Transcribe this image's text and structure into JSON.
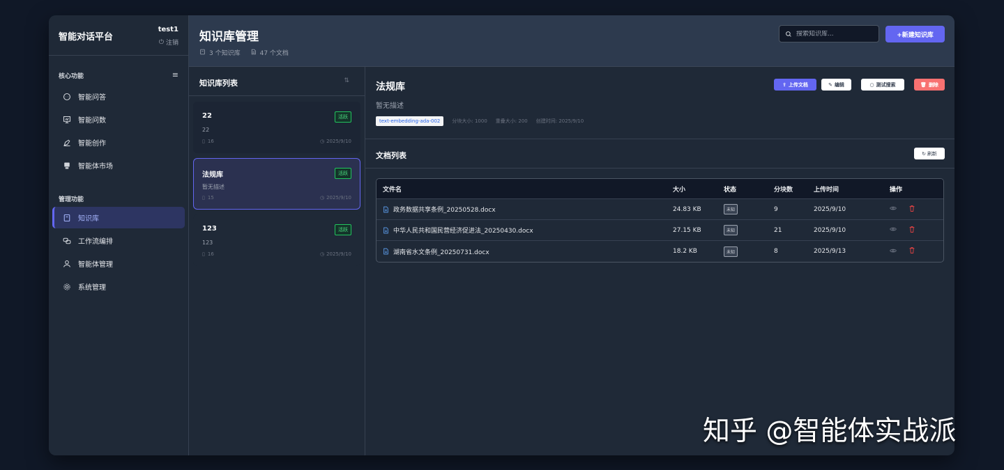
{
  "sidebar": {
    "brand": "智能对话平台",
    "user": "test1",
    "logout": "注销",
    "section_core": "核心功能",
    "section_manage": "管理功能",
    "core_items": [
      {
        "label": "智能问答",
        "icon": "chat-icon"
      },
      {
        "label": "智能问数",
        "icon": "chart-icon"
      },
      {
        "label": "智能创作",
        "icon": "pen-icon"
      },
      {
        "label": "智能体市场",
        "icon": "store-icon"
      }
    ],
    "manage_items": [
      {
        "label": "知识库",
        "icon": "book-icon",
        "active": true
      },
      {
        "label": "工作流编排",
        "icon": "workflow-icon"
      },
      {
        "label": "智能体管理",
        "icon": "user-icon"
      },
      {
        "label": "系统管理",
        "icon": "gear-icon"
      }
    ]
  },
  "header": {
    "title": "知识库管理",
    "kb_count": "3 个知识库",
    "doc_count": "47 个文档",
    "search_placeholder": "搜索知识库...",
    "new_button": "+新建知识库"
  },
  "kb_list": {
    "title": "知识库列表",
    "items": [
      {
        "name": "22",
        "desc": "22",
        "docs": "16",
        "date": "2025/9/10",
        "status": "活跃"
      },
      {
        "name": "法规库",
        "desc": "暂无描述",
        "docs": "15",
        "date": "2025/9/10",
        "status": "活跃"
      },
      {
        "name": "123",
        "desc": "123",
        "docs": "16",
        "date": "2025/9/10",
        "status": "活跃"
      }
    ]
  },
  "detail": {
    "title": "法规库",
    "desc": "暂无描述",
    "model": "text-embedding-ada-002",
    "chunk_size": "分块大小: 1000",
    "overlap": "重叠大小: 200",
    "created": "创建时间: 2025/9/10",
    "buttons": {
      "upload": "上传文档",
      "edit": "编辑",
      "test": "测试搜索",
      "delete": "删除"
    },
    "doc_list_title": "文档列表",
    "refresh": "刷新",
    "columns": [
      "文件名",
      "大小",
      "状态",
      "分块数",
      "上传时间",
      "操作"
    ],
    "docs": [
      {
        "name": "政务数据共享条例_20250528.docx",
        "size": "24.83 KB",
        "status": "未知",
        "chunks": "9",
        "time": "2025/9/10"
      },
      {
        "name": "中华人民共和国民营经济促进法_20250430.docx",
        "size": "27.15 KB",
        "status": "未知",
        "chunks": "21",
        "time": "2025/9/10"
      },
      {
        "name": "湖南省水文条例_20250731.docx",
        "size": "18.2 KB",
        "status": "未知",
        "chunks": "8",
        "time": "2025/9/13"
      }
    ]
  },
  "watermark": "知乎 @智能体实战派",
  "colors": {
    "accent": "#6366f1",
    "danger": "#f87171",
    "success": "#22c55e",
    "background": "#101827"
  }
}
